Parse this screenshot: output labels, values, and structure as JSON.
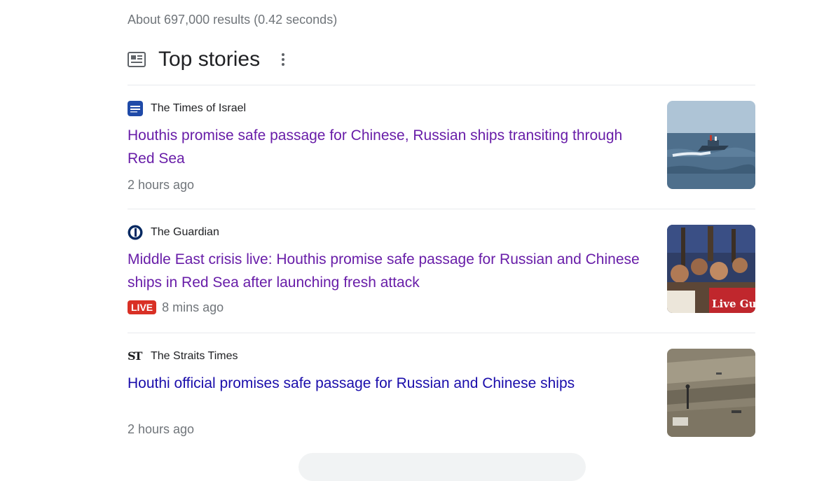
{
  "results": {
    "count_text": "About 697,000 results (0.42 seconds)"
  },
  "top_stories": {
    "title": "Top stories",
    "stories": [
      {
        "source": "The Times of Israel",
        "headline": "Houthis promise safe passage for Chinese, Russian ships transiting through Red Sea",
        "time": "2 hours ago",
        "thumbnail": "boat-at-sea-image"
      },
      {
        "source": "The Guardian",
        "headline": "Middle East crisis live: Houthis promise safe passage for Russian and Chinese ships in Red Sea after launching fresh attack",
        "live_badge": "LIVE",
        "time": "8 mins ago",
        "thumbnail": "crowd-protest-image",
        "thumbnail_caption": "Live Gu"
      },
      {
        "source": "The Straits Times",
        "source_logo_text": "ST",
        "headline": "Houthi official promises safe passage for Russian and Chinese ships",
        "time": "2 hours ago",
        "thumbnail": "ship-deck-aerial-image"
      }
    ]
  },
  "colors": {
    "visited_link": "#681da8",
    "link": "#1a0dab",
    "meta_text": "#70757a",
    "live_red": "#d93025"
  }
}
